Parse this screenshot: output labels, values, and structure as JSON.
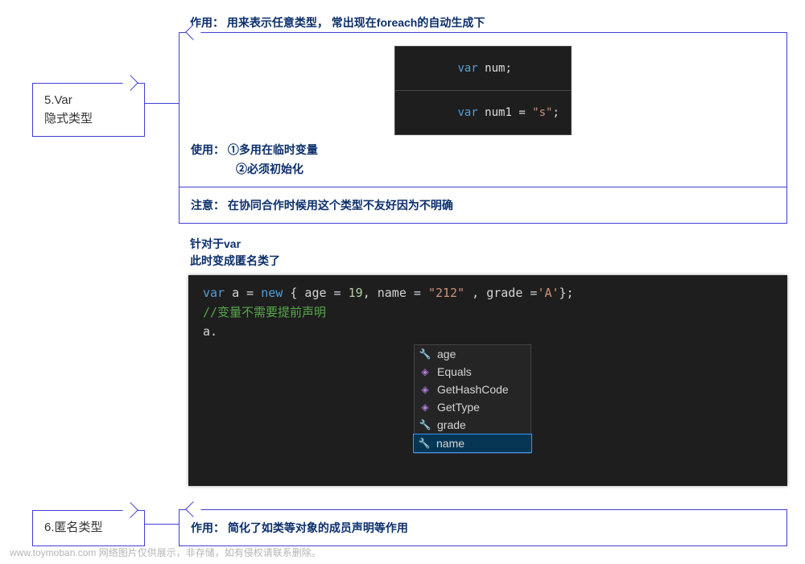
{
  "node5": {
    "title_line1": "5.Var",
    "title_line2": "隐式类型"
  },
  "node6": {
    "title": "6.匿名类型"
  },
  "panel5": {
    "purpose_label": "作用：",
    "purpose_text": "用来表示任意类型， 常出现在foreach的自动生成下",
    "usage_label": "使用：",
    "usage_line1": "①多用在临时变量",
    "usage_line2": "②必须初始化",
    "note_label": "注意：",
    "note_text": "在协同合作时候用这个类型不友好因为不明确"
  },
  "code1": {
    "line1_kw": "var",
    "line1_rest": " num;",
    "line2_kw": "var",
    "line2_ident": " num1 ",
    "line2_eq": "= ",
    "line2_str": "\"s\"",
    "line2_end": ";"
  },
  "intro": {
    "line1": "针对于var",
    "line2": "此时变成匿名类了"
  },
  "code2": {
    "kw_var": "var",
    "sp": " ",
    "a": "a",
    "eq": " = ",
    "kw_new": "new",
    "open": " { age = ",
    "n19": "19",
    "c1": ", name = ",
    "s212": "\"212\"",
    "c2": " , grade =",
    "ca": "'A'",
    "close": "};",
    "comment": "//变量不需要提前声明",
    "a_dot": "a."
  },
  "intellisense": [
    {
      "icon": "wrench",
      "label": "age"
    },
    {
      "icon": "cube",
      "label": "Equals"
    },
    {
      "icon": "cube",
      "label": "GetHashCode"
    },
    {
      "icon": "cube",
      "label": "GetType"
    },
    {
      "icon": "wrench",
      "label": "grade"
    },
    {
      "icon": "wrench",
      "label": "name"
    }
  ],
  "panel6": {
    "purpose_label": "作用：",
    "purpose_text": "简化了如类等对象的成员声明等作用"
  },
  "footer": "www.toymoban.com 网络图片仅供展示，非存储，如有侵权请联系删除。"
}
